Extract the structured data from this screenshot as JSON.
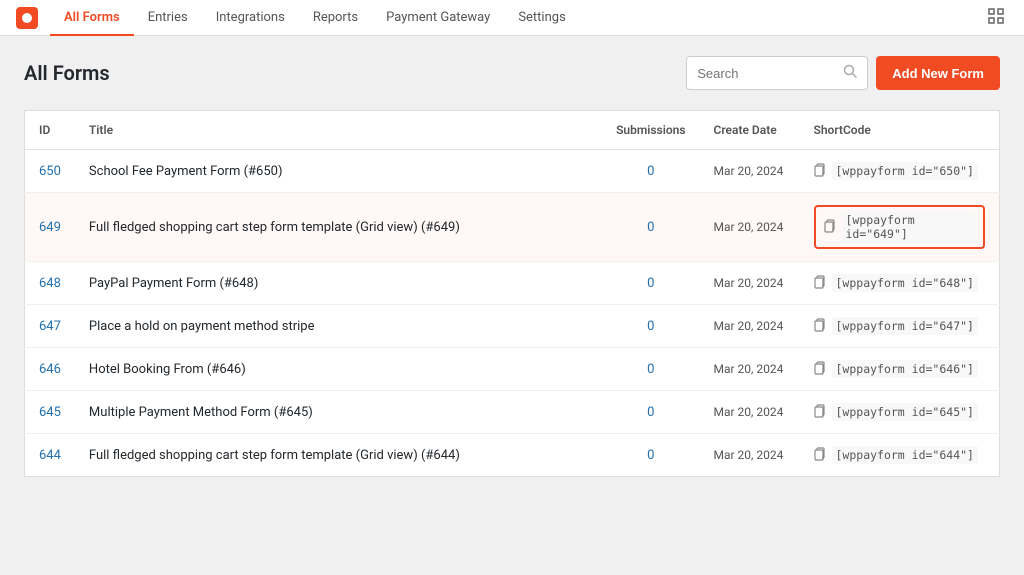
{
  "nav": {
    "items": [
      {
        "label": "All Forms",
        "active": true
      },
      {
        "label": "Entries",
        "active": false
      },
      {
        "label": "Integrations",
        "active": false
      },
      {
        "label": "Reports",
        "active": false
      },
      {
        "label": "Payment Gateway",
        "active": false
      },
      {
        "label": "Settings",
        "active": false
      }
    ]
  },
  "page": {
    "title": "All Forms",
    "search_placeholder": "Search",
    "add_button_label": "Add New Form"
  },
  "table": {
    "columns": {
      "id": "ID",
      "title": "Title",
      "submissions": "Submissions",
      "create_date": "Create Date",
      "shortcode": "ShortCode"
    },
    "rows": [
      {
        "id": "650",
        "title": "School Fee Payment Form (#650)",
        "submissions": "0",
        "date": "Mar 20, 2024",
        "shortcode": "[wppayform id=\"650\"]",
        "highlighted": false
      },
      {
        "id": "649",
        "title": "Full fledged shopping cart step form template (Grid view) (#649)",
        "submissions": "0",
        "date": "Mar 20, 2024",
        "shortcode": "[wppayform id=\"649\"]",
        "highlighted": true
      },
      {
        "id": "648",
        "title": "PayPal Payment Form (#648)",
        "submissions": "0",
        "date": "Mar 20, 2024",
        "shortcode": "[wppayform id=\"648\"]",
        "highlighted": false
      },
      {
        "id": "647",
        "title": "Place a hold on payment method stripe",
        "submissions": "0",
        "date": "Mar 20, 2024",
        "shortcode": "[wppayform id=\"647\"]",
        "highlighted": false
      },
      {
        "id": "646",
        "title": "Hotel Booking From (#646)",
        "submissions": "0",
        "date": "Mar 20, 2024",
        "shortcode": "[wppayform id=\"646\"]",
        "highlighted": false
      },
      {
        "id": "645",
        "title": "Multiple Payment Method Form (#645)",
        "submissions": "0",
        "date": "Mar 20, 2024",
        "shortcode": "[wppayform id=\"645\"]",
        "highlighted": false
      },
      {
        "id": "644",
        "title": "Full fledged shopping cart step form template (Grid view) (#644)",
        "submissions": "0",
        "date": "Mar 20, 2024",
        "shortcode": "[wppayform id=\"644\"]",
        "highlighted": false
      }
    ]
  }
}
